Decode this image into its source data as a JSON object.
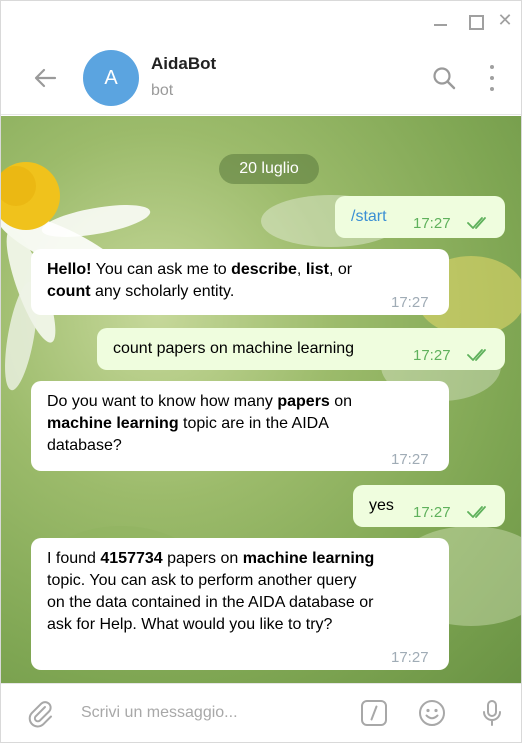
{
  "window": {
    "title_controls": [
      "minimize",
      "maximize",
      "close"
    ],
    "close_glyph": "✕"
  },
  "header": {
    "avatar_letter": "A",
    "title": "AidaBot",
    "subtitle": "bot",
    "avatar_color": "#5ba4e0"
  },
  "chat": {
    "date": "20 luglio",
    "messages": [
      {
        "direction": "out",
        "text": "/start",
        "time": "17:27",
        "read": true
      },
      {
        "direction": "in",
        "line1_a": "Hello!",
        "line1_b": " You can ask me to ",
        "line1_c": "describe",
        "line1_d": ", ",
        "line1_e": "list",
        "line1_f": ", or",
        "line2_a": "count",
        "line2_b": " any scholarly entity.",
        "time": "17:27"
      },
      {
        "direction": "out",
        "text": "count papers on machine learning",
        "time": "17:27",
        "read": true
      },
      {
        "direction": "in",
        "line1_a": "Do you want to know how many ",
        "line1_b": "papers",
        "line1_c": " on",
        "line2_a": "machine learning",
        "line2_b": " topic are in the AIDA",
        "line3": "database?",
        "time": "17:27"
      },
      {
        "direction": "out",
        "text": "yes",
        "time": "17:27",
        "read": true
      },
      {
        "direction": "in",
        "line1_a": "I found ",
        "line1_b": "4157734",
        "line1_c": " papers on ",
        "line1_d": "machine learning",
        "line2": "topic. You can ask to perform another query",
        "line3": "on the data contained in the AIDA database or",
        "line4": "ask for Help. What would you like to try?",
        "time": "17:27"
      }
    ]
  },
  "composer": {
    "placeholder": "Scrivi un messaggio...",
    "icons": [
      "paperclip-icon",
      "bot-command-icon",
      "emoji-icon",
      "microphone-icon"
    ],
    "command_glyph": "/"
  },
  "colors": {
    "accent": "#5ba4e0",
    "outgoing_bubble": "#effdde",
    "incoming_bubble": "#ffffff",
    "outgoing_time": "#5fb15c"
  }
}
